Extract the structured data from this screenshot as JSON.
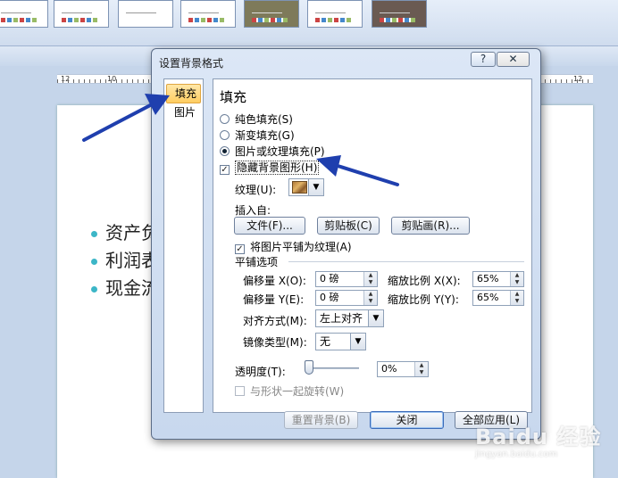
{
  "ruler": {
    "left_label": "12",
    "mid_label": "10",
    "right_label": "12"
  },
  "slide": {
    "bullets": [
      "资产负",
      "利润表",
      "现金流"
    ]
  },
  "dialog": {
    "title": "设置背景格式",
    "help_label": "?",
    "close_label": "✕",
    "nav": [
      {
        "label": "填充",
        "selected": true
      },
      {
        "label": "图片",
        "selected": false
      }
    ],
    "section_title": "填充",
    "fill_options": [
      {
        "label": "纯色填充(S)",
        "selected": false
      },
      {
        "label": "渐变填充(G)",
        "selected": false
      },
      {
        "label": "图片或纹理填充(P)",
        "selected": true
      }
    ],
    "hide_background": {
      "label": "隐藏背景图形(H)",
      "checked": true
    },
    "texture": {
      "label": "纹理(U):",
      "icon": "texture-swatch-icon",
      "drop_glyph": "▼"
    },
    "insert_from": {
      "label": "插入自:",
      "buttons": [
        "文件(F)...",
        "剪贴板(C)",
        "剪贴画(R)..."
      ]
    },
    "tile": {
      "label": "将图片平铺为纹理(A)",
      "checked": true
    },
    "tile_options": {
      "group_label": "平铺选项",
      "offset_x": {
        "label": "偏移量 X(O):",
        "value": "0 磅"
      },
      "scale_x": {
        "label": "缩放比例 X(X):",
        "value": "65%"
      },
      "offset_y": {
        "label": "偏移量 Y(E):",
        "value": "0 磅"
      },
      "scale_y": {
        "label": "缩放比例 Y(Y):",
        "value": "65%"
      },
      "align": {
        "label": "对齐方式(M):",
        "value": "左上对齐"
      },
      "mirror": {
        "label": "镜像类型(M):",
        "value": "无"
      }
    },
    "transparency": {
      "label": "透明度(T):",
      "value": "0%",
      "level": 0
    },
    "rotate_with_shape": {
      "label": "与形状一起旋转(W)",
      "checked": false,
      "enabled": false
    },
    "footer": {
      "reset": "重置背景(B)",
      "close": "关闭",
      "apply_all": "全部应用(L)"
    }
  },
  "watermark": {
    "brand": "Baidu 经验",
    "url": "jingyan.baidu.com"
  },
  "colors": {
    "arrow": "#1f3fae",
    "selected_nav": "#ffcd61",
    "bullet": "#3cb6c7"
  }
}
